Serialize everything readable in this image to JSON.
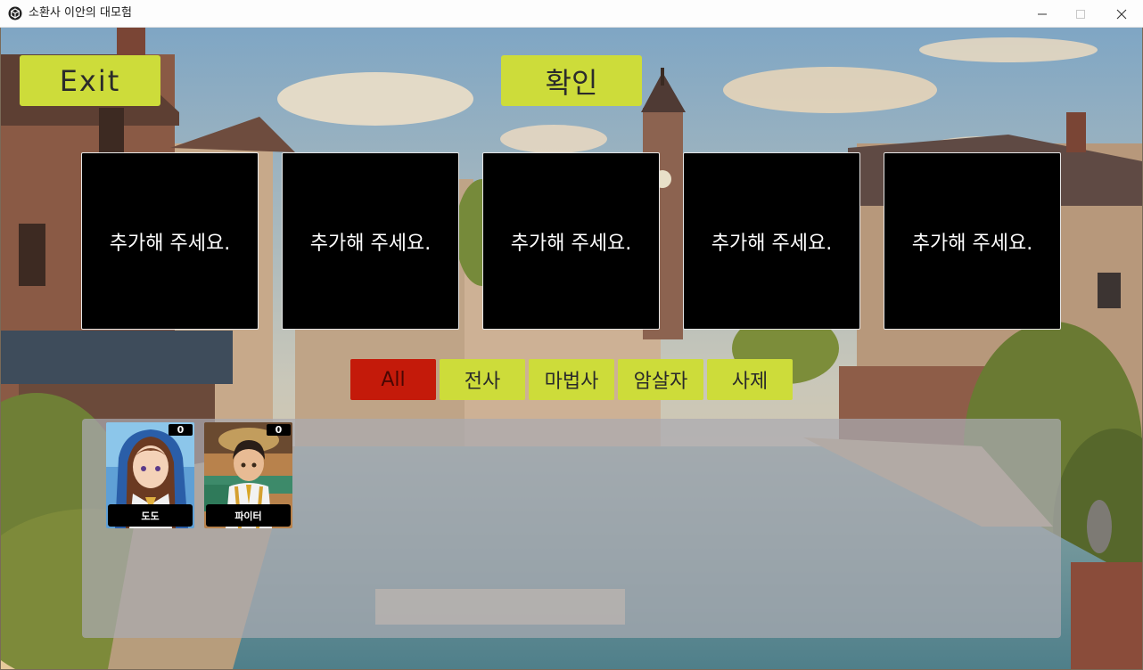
{
  "window": {
    "title": "소환사 이안의 대모험",
    "icon": "unity-cube-icon"
  },
  "toolbar": {
    "exit_label": "Exit",
    "confirm_label": "확인"
  },
  "slots": [
    {
      "label": "추가해 주세요."
    },
    {
      "label": "추가해 주세요."
    },
    {
      "label": "추가해 주세요."
    },
    {
      "label": "추가해 주세요."
    },
    {
      "label": "추가해 주세요."
    }
  ],
  "filter_tabs": [
    {
      "label": "All",
      "active": true
    },
    {
      "label": "전사",
      "active": false
    },
    {
      "label": "마법사",
      "active": false
    },
    {
      "label": "암살자",
      "active": false
    },
    {
      "label": "사제",
      "active": false
    }
  ],
  "cards": [
    {
      "name": "도도",
      "count": "0"
    },
    {
      "name": "파이터",
      "count": "0"
    }
  ],
  "colors": {
    "button_yellow": "#cddc3a",
    "tab_active_red": "#c41a0a",
    "slot_black": "#000000"
  }
}
